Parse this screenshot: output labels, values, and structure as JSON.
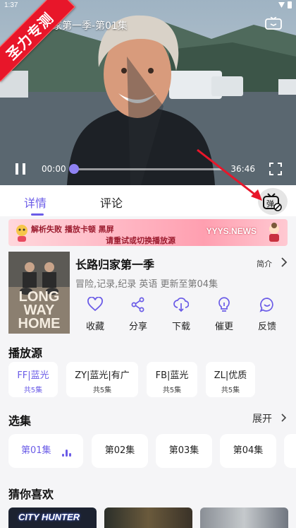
{
  "status_bar": {
    "time": "1:37"
  },
  "player": {
    "title": "归家第一季-第01集",
    "watermark": "圣力专测",
    "current_time": "00:00",
    "total_time": "36:46",
    "progress": 0,
    "accent_color": "#8f82f2"
  },
  "tabs": [
    {
      "label": "详情",
      "active": true
    },
    {
      "label": "评论",
      "active": false
    }
  ],
  "danmu_button": {
    "label": "弹"
  },
  "banner": {
    "line1": "解析失败  播放卡顿  黑屏",
    "line2": "请重试或切换播放源",
    "site": "YYYS.NEWS"
  },
  "show": {
    "poster_text": "LONG WAY HOME",
    "title": "长路归家第一季",
    "intro_label": "简介",
    "meta": "冒险,记录,纪录 英语 更新至第04集",
    "actions": [
      {
        "label": "收藏",
        "icon": "heart-icon"
      },
      {
        "label": "分享",
        "icon": "share-icon"
      },
      {
        "label": "下载",
        "icon": "download-icon"
      },
      {
        "label": "催更",
        "icon": "bulb-icon"
      },
      {
        "label": "反馈",
        "icon": "feedback-icon"
      }
    ]
  },
  "sources": {
    "title": "播放源",
    "items": [
      {
        "name": "FF|蓝光",
        "count": "共5集",
        "selected": true
      },
      {
        "name": "ZY|蓝光|有广",
        "count": "共5集",
        "selected": false
      },
      {
        "name": "FB|蓝光",
        "count": "共5集",
        "selected": false
      },
      {
        "name": "ZL|优质",
        "count": "共5集",
        "selected": false
      }
    ]
  },
  "episodes": {
    "title": "选集",
    "expand_label": "展开",
    "items": [
      {
        "label": "第01集",
        "selected": true
      },
      {
        "label": "第02集",
        "selected": false
      },
      {
        "label": "第03集",
        "selected": false
      },
      {
        "label": "第04集",
        "selected": false
      }
    ]
  },
  "recommend": {
    "title": "猜你喜欢",
    "items": [
      {
        "poster_text": "CITY HUNTER"
      },
      {
        "poster_text": ""
      },
      {
        "poster_text": ""
      }
    ]
  },
  "colors": {
    "accent": "#6b5ce7",
    "arrow": "#e8162a"
  }
}
